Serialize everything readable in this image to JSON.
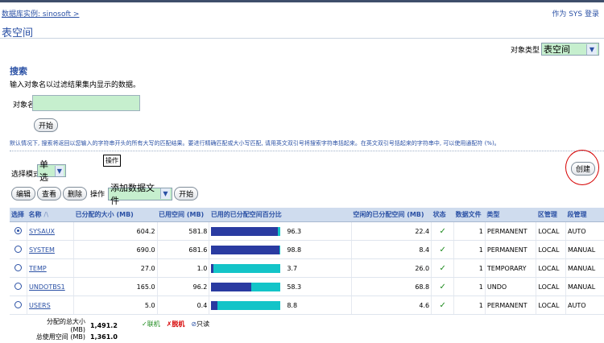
{
  "header": {
    "breadcrumb": "数据库实例: sinosoft  >",
    "login": "作为 SYS 登录",
    "title": "表空间"
  },
  "object_type": {
    "label": "对象类型",
    "value": "表空间"
  },
  "search": {
    "title": "搜索",
    "description": "输入对象名以过滤结果集内显示的数据。",
    "name_label": "对象名",
    "name_value": "",
    "go_label": "开始",
    "hint": "默认情况下, 搜索将返回以您输入的字符串开头的所有大写的匹配结果。要进行精确匹配或大小写匹配, 请用英文双引号将搜索字符串括起来。在英文双引号括起来的字符串中, 可以使用通配符 (%)。"
  },
  "selection": {
    "tooltip": "操作",
    "mode_label": "选择模式",
    "mode_value": "单选",
    "create_label": "创建"
  },
  "toolbar": {
    "edit": "编辑",
    "view": "查看",
    "delete": "删除",
    "op_label": "操作",
    "action_value": "添加数据文件",
    "go": "开始"
  },
  "table": {
    "headers": {
      "select": "选择",
      "name": "名称",
      "allocated": "已分配的大小 (MB)",
      "used": "已用空间 (MB)",
      "used_pct": "已用的已分配空间百分比",
      "free": "空闲的已分配空间 (MB)",
      "status": "状态",
      "files": "数据文件",
      "type": "类型",
      "extent": "区管理",
      "segment": "段管理"
    },
    "rows": [
      {
        "name": "SYSAUX",
        "allocated": "604.2",
        "used": "581.8",
        "pct": 96.3,
        "pct_label": "96.3",
        "free": "22.4",
        "status": "✓",
        "files": "1",
        "type": "PERMANENT",
        "extent": "LOCAL",
        "segment": "AUTO"
      },
      {
        "name": "SYSTEM",
        "allocated": "690.0",
        "used": "681.6",
        "pct": 98.8,
        "pct_label": "98.8",
        "free": "8.4",
        "status": "✓",
        "files": "1",
        "type": "PERMANENT",
        "extent": "LOCAL",
        "segment": "MANUAL"
      },
      {
        "name": "TEMP",
        "allocated": "27.0",
        "used": "1.0",
        "pct": 3.7,
        "pct_label": "3.7",
        "free": "26.0",
        "status": "✓",
        "files": "1",
        "type": "TEMPORARY",
        "extent": "LOCAL",
        "segment": "MANUAL"
      },
      {
        "name": "UNDOTBS1",
        "allocated": "165.0",
        "used": "96.2",
        "pct": 58.3,
        "pct_label": "58.3",
        "free": "68.8",
        "status": "✓",
        "files": "1",
        "type": "UNDO",
        "extent": "LOCAL",
        "segment": "MANUAL"
      },
      {
        "name": "USERS",
        "allocated": "5.0",
        "used": "0.4",
        "pct": 8.8,
        "pct_label": "8.8",
        "free": "4.6",
        "status": "✓",
        "files": "1",
        "type": "PERMANENT",
        "extent": "LOCAL",
        "segment": "AUTO"
      }
    ]
  },
  "summary": {
    "allocated_label": "分配的总大小 (MB)",
    "allocated_value": "1,491.2",
    "used_label": "总使用空间 (MB)",
    "used_value": "1,361.0"
  },
  "legend": {
    "online": "✓联机",
    "offline": "✗脱机",
    "readonly": "只读"
  },
  "colors": {
    "accent": "#2b51a5",
    "bar_used": "#2a3ba1",
    "bar_free": "#13c4c8",
    "input_bg": "#c6efce"
  }
}
